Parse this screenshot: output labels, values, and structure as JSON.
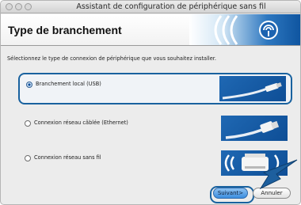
{
  "window": {
    "title": "Assistant de configuration de périphérique sans fil"
  },
  "banner": {
    "title": "Type de branchement",
    "icon": "wireless-icon"
  },
  "instruction": "Sélectionnez le type de connexion de périphérique que vous souhaitez installer.",
  "options": [
    {
      "label": "Branchement local (USB)",
      "selected": true,
      "icon": "usb-cable-icon"
    },
    {
      "label": "Connexion réseau câblée (Ethernet)",
      "selected": false,
      "icon": "ethernet-cable-icon"
    },
    {
      "label": "Connexion réseau sans fil",
      "selected": false,
      "icon": "wireless-printer-icon"
    }
  ],
  "buttons": {
    "next_label": "Suivant>",
    "cancel_label": "Annuler"
  },
  "colors": {
    "accent": "#19629f",
    "banner_blue": "#0f55a0"
  }
}
